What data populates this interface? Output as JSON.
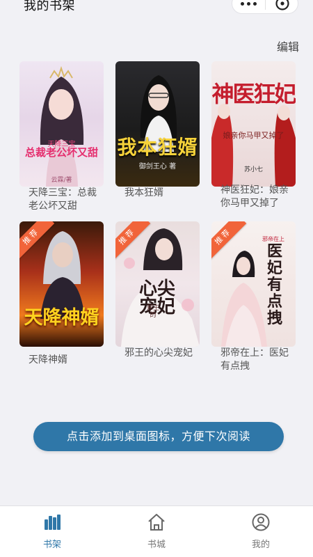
{
  "header": {
    "title": "我的书架",
    "edit_label": "编辑"
  },
  "capsule": {
    "more_icon": "more-dots-icon",
    "close_icon": "close-circle-icon"
  },
  "books": [
    {
      "title": "天降三宝：总裁老公坏又甜",
      "cover_text": "天降三宝",
      "cover_text2": "总裁老公坏又甜",
      "cover_author": "云霖/著",
      "badge": ""
    },
    {
      "title": "我本狂婿",
      "cover_text": "我本狂婿",
      "cover_author": "御剑王心 著",
      "badge": ""
    },
    {
      "title": "神医狂妃：娘亲你马甲又掉了",
      "cover_text": "神医狂妃",
      "cover_text2": "娘亲你马甲又掉了",
      "cover_author": "苏小七",
      "badge": ""
    },
    {
      "title": "天降神婿",
      "cover_text": "天降神婿",
      "badge": "推荐"
    },
    {
      "title": "邪王的心尖宠妃",
      "cover_text": "心尖宠妃",
      "cover_text2": "邪王的",
      "badge": "推荐"
    },
    {
      "title": "邪帝在上：医妃有点拽",
      "cover_text": "医妃有点拽",
      "cover_text2": "邪帝在上",
      "badge": "推荐"
    }
  ],
  "add_desktop_button": "点击添加到桌面图标，方便下次阅读",
  "tabs": [
    {
      "label": "书架",
      "icon": "bookshelf-icon",
      "active": true
    },
    {
      "label": "书城",
      "icon": "home-icon",
      "active": false
    },
    {
      "label": "我的",
      "icon": "profile-icon",
      "active": false
    }
  ],
  "colors": {
    "accent": "#2f77a8",
    "badge": "#f1643a",
    "background": "#f1f1f5"
  }
}
